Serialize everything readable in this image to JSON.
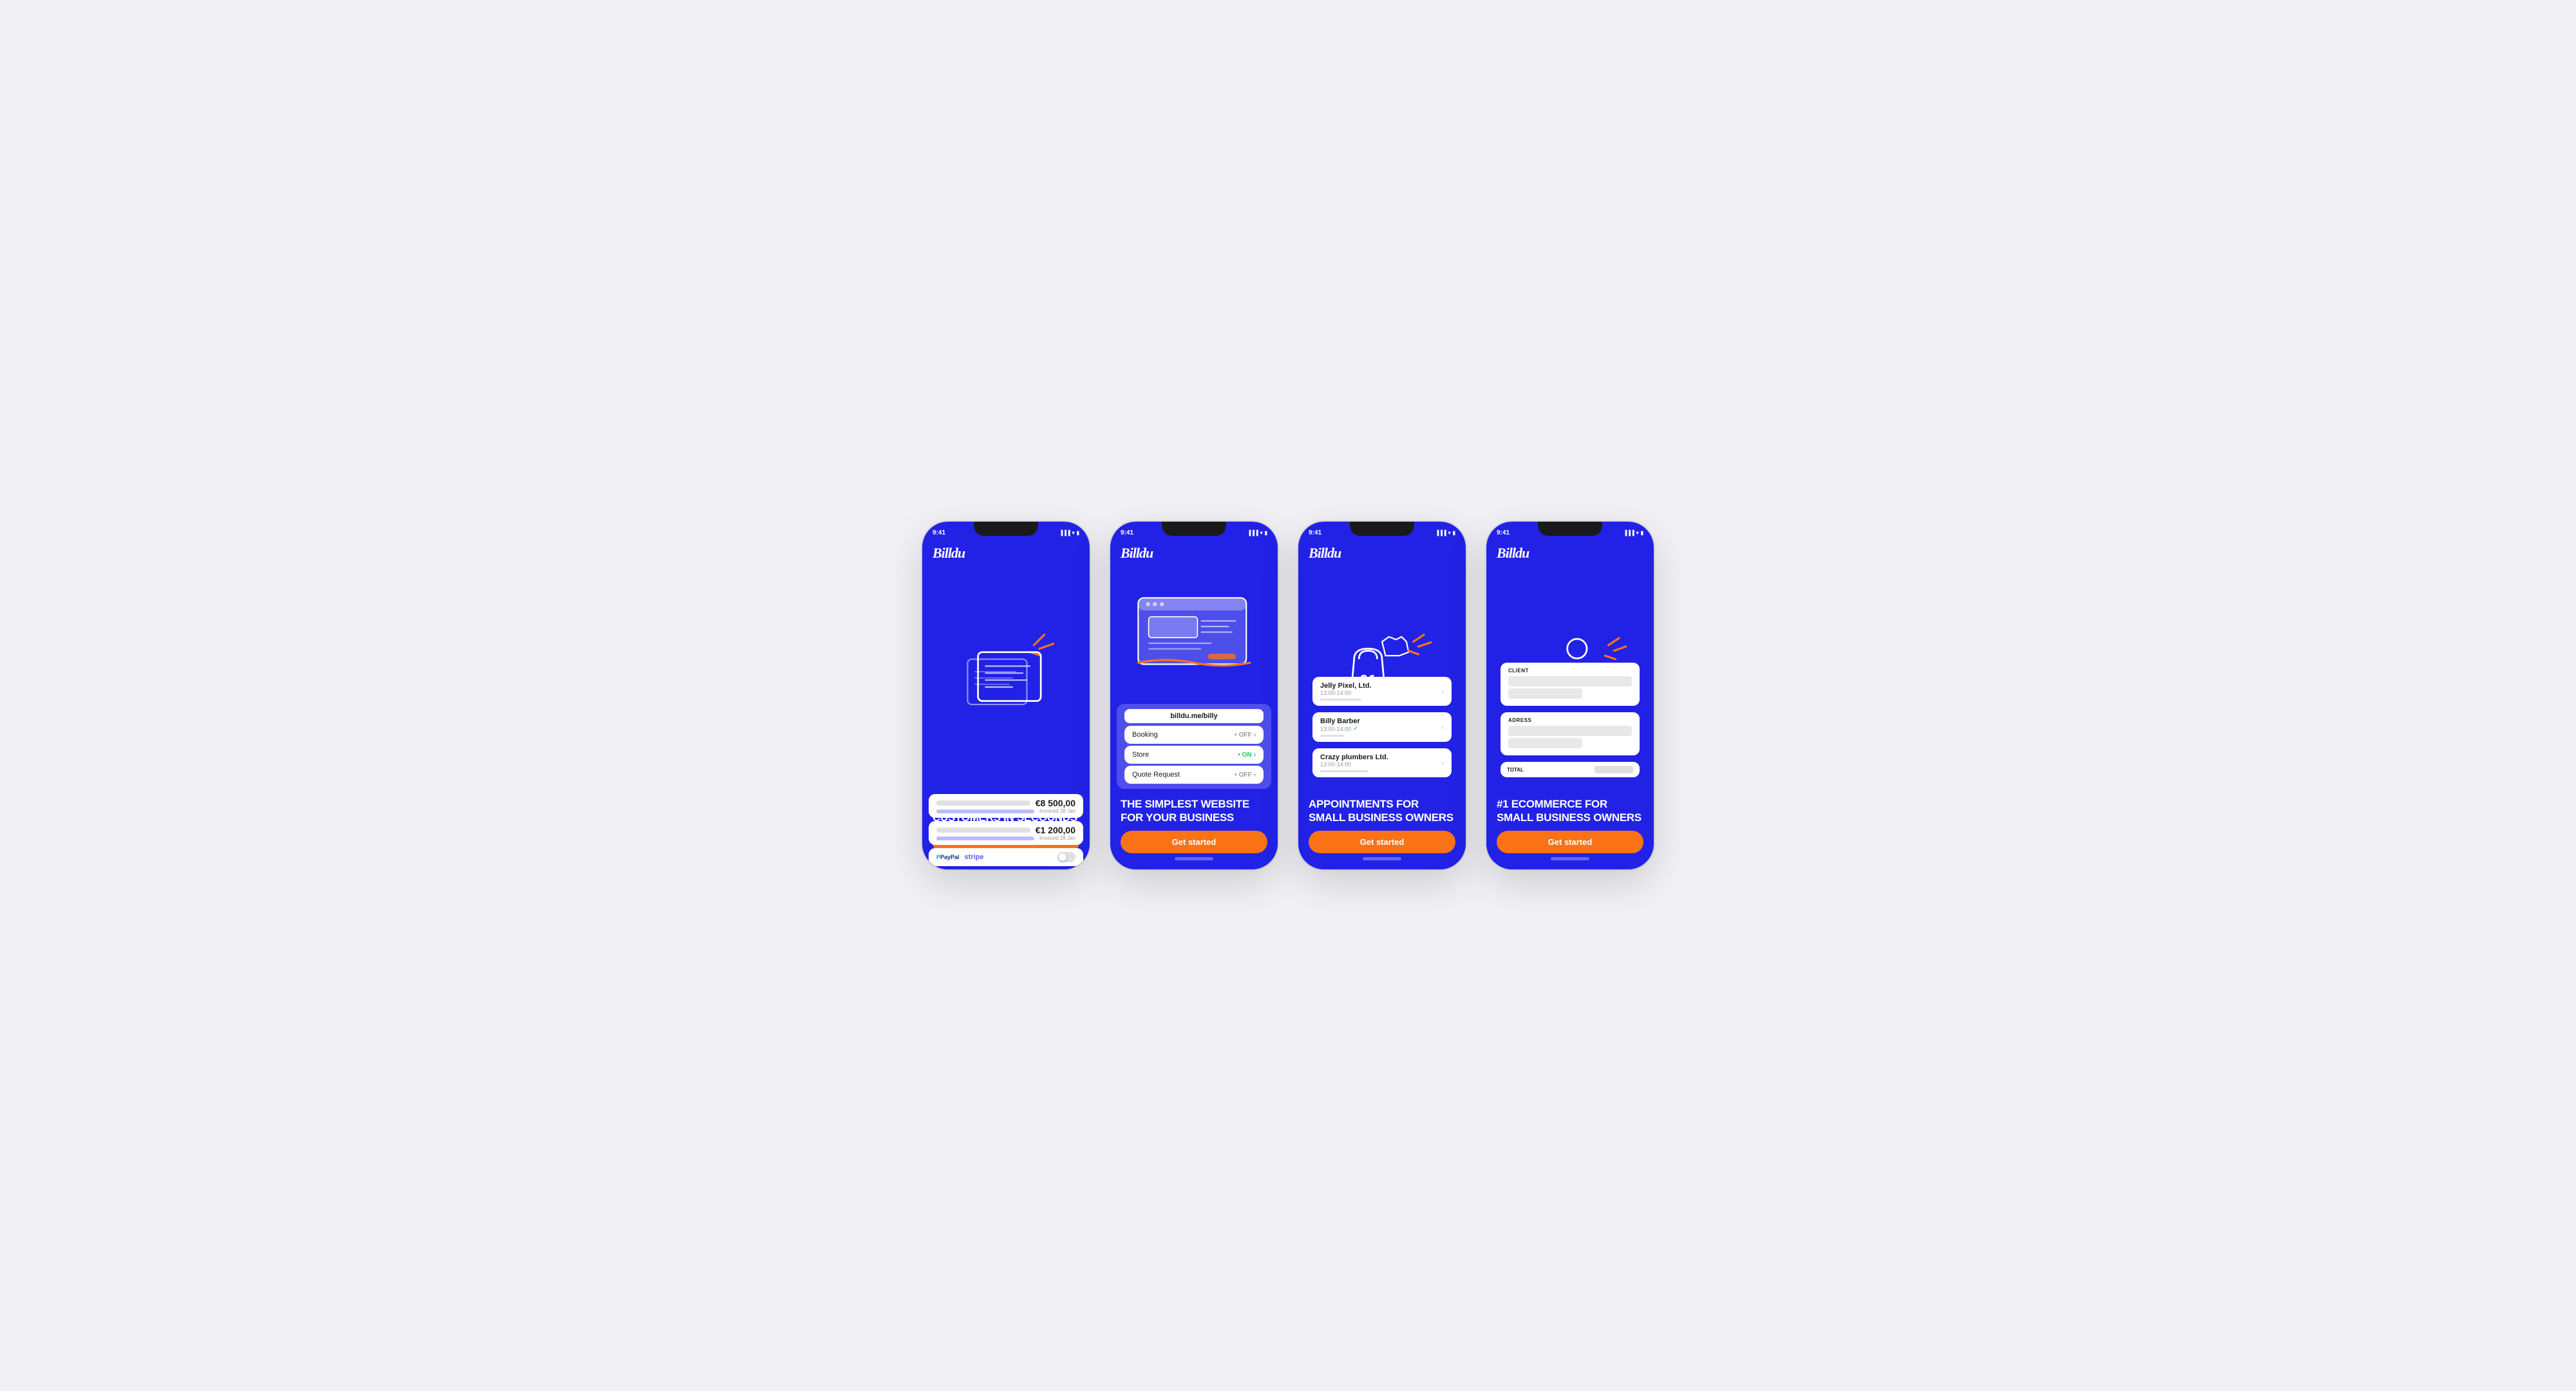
{
  "phones": [
    {
      "id": "phone1",
      "status_time": "9:41",
      "logo": "Billdu",
      "illustration_type": "invoice",
      "invoice": {
        "amount1": "€8 500,00",
        "date1": "Invoiced 28 Jan",
        "bar1_width": "80%",
        "amount2": "€1 200,00",
        "date2": "Invoiced 28 Jan",
        "bar2_width": "40%",
        "paypal": "PayPal",
        "stripe": "stripe"
      },
      "tagline": "INVOICE YOUR CUSTOMERS IN SECOUNDS",
      "cta": "Get started"
    },
    {
      "id": "phone2",
      "status_time": "9:41",
      "logo": "Billdu",
      "illustration_type": "website",
      "website": {
        "url": "billdu.me/billy",
        "features": [
          {
            "name": "Booking",
            "status": "OFF",
            "on": false
          },
          {
            "name": "Store",
            "status": "ON",
            "on": true
          },
          {
            "name": "Quote Request",
            "status": "OFF",
            "on": false
          }
        ]
      },
      "tagline": "THE SIMPLEST WEBSITE FOR YOUR BUSINESS",
      "cta": "Get started"
    },
    {
      "id": "phone3",
      "status_time": "9:41",
      "logo": "Billdu",
      "illustration_type": "appointments",
      "appointments": [
        {
          "name": "Jelly Pixel, Ltd.",
          "time": "13:00-14:00",
          "checked": false
        },
        {
          "name": "Billy Barber",
          "time": "13:00-14:00",
          "checked": true
        },
        {
          "name": "Crazy plumbers Ltd.",
          "time": "13:00-14:00",
          "checked": false
        }
      ],
      "tagline": "APPOINTMENTS FOR SMALL BUSINESS OWNERS",
      "cta": "Get started"
    },
    {
      "id": "phone4",
      "status_time": "9:41",
      "logo": "Billdu",
      "illustration_type": "ecommerce",
      "ecommerce": {
        "client_label": "CLIENT",
        "address_label": "ADRESS",
        "total_label": "TOTAL"
      },
      "tagline": "#1 ECOMMERCE FOR SMALL BUSINESS OWNERS",
      "cta": "Get started"
    }
  ]
}
